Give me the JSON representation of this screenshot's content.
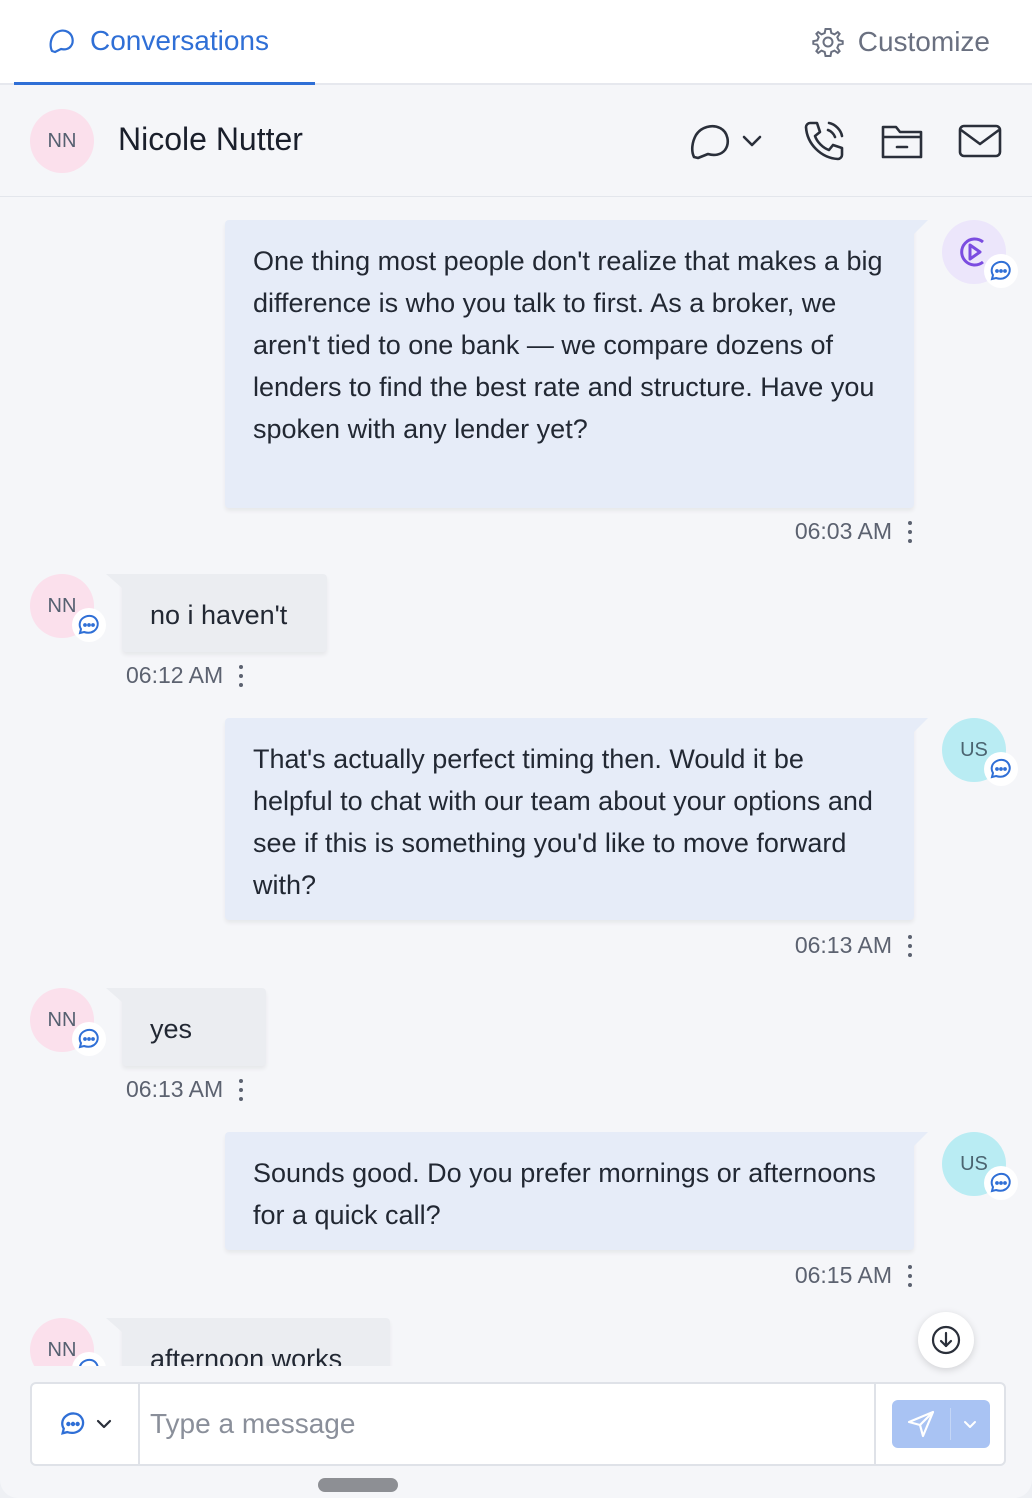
{
  "tabs": {
    "conversations": "Conversations",
    "customize": "Customize"
  },
  "contact": {
    "initials": "NN",
    "name": "Nicole Nutter"
  },
  "messages": [
    {
      "direction": "outgoing",
      "sender": "bot",
      "text": "One thing most people don't realize that makes a big difference is who you talk to first. As a broker, we aren't tied to one bank — we compare dozens of lenders to find the best rate and structure. Have you spoken with any lender yet?",
      "time": "06:03 AM"
    },
    {
      "direction": "incoming",
      "sender": "NN",
      "text": "no i haven't",
      "time": "06:12 AM"
    },
    {
      "direction": "outgoing",
      "sender": "US",
      "text": "That's actually perfect timing then. Would it be helpful to chat with our team about your options and see if this is something you'd like to move forward with?",
      "time": "06:13 AM"
    },
    {
      "direction": "incoming",
      "sender": "NN",
      "text": "yes",
      "time": "06:13 AM"
    },
    {
      "direction": "outgoing",
      "sender": "US",
      "text": "Sounds good. Do you prefer mornings or afternoons for a quick call?",
      "time": "06:15 AM"
    },
    {
      "direction": "incoming",
      "sender": "NN",
      "text": "afternoon works",
      "time": ""
    }
  ],
  "composer": {
    "placeholder": "Type a message"
  },
  "colors": {
    "accent": "#2f6fd6",
    "outgoing_bubble": "#e6ecf8",
    "incoming_bubble": "#ebedf1",
    "contact_avatar": "#fbe0ec",
    "user_avatar": "#b9ecf3",
    "bot_icon": "#7b4ce0",
    "send_button": "#a9c3f3"
  },
  "icons": [
    "chat-bubble-icon",
    "gear-icon",
    "chevron-down-icon",
    "phone-icon",
    "folder-icon",
    "mail-icon",
    "bot-play-icon",
    "arrow-down-icon",
    "send-icon"
  ]
}
